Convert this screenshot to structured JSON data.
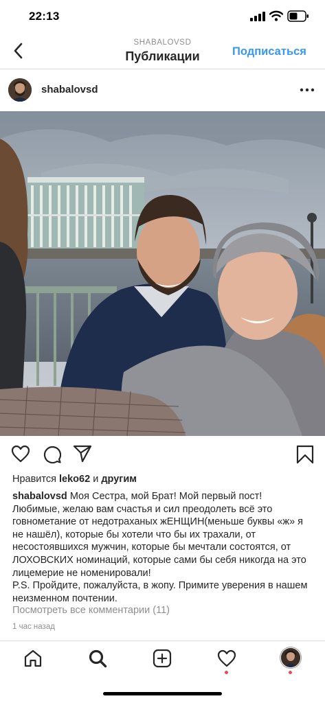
{
  "status_bar": {
    "time": "22:13",
    "signal_icon": "cellular-signal-icon",
    "wifi_icon": "wifi-icon",
    "battery_icon": "battery-icon"
  },
  "header": {
    "back_icon": "chevron-left-icon",
    "username": "SHABALOVSD",
    "title": "Публикации",
    "follow_label": "Подписаться",
    "accent_color": "#3897f0"
  },
  "post": {
    "username": "shabalovsd",
    "more_icon": "more-horizontal-icon",
    "photo_description_icon": "photo",
    "actions": {
      "like_icon": "heart-icon",
      "comment_icon": "comment-icon",
      "share_icon": "send-icon",
      "save_icon": "bookmark-icon"
    },
    "likes": {
      "prefix": "Нравится",
      "user": "leko62",
      "connector": "и",
      "others": "другим"
    },
    "caption": {
      "user": "shabalovsd",
      "text": "Моя Сестра, мой Брат! Мой первый пост!\nЛюбимые, желаю вам счастья и сил преодолеть всё это говнометание от недотраханых  жЕНЩИН(меньше буквы «ж» я не нашёл), которые бы хотели что бы их трахали, от несостоявшихся мужчин, которые  бы мечтали состоятся, от ЛОХОВСКИХ номинаций, которые сами бы себя никогда на это лицемерие не номенировали!\nP.S. Пройдите, пожалуйста, в жопу. Примите уверения в нашем неизменном почтении."
    },
    "view_comments": "Посмотреть все комментарии (11)",
    "time_ago": "1 час назад"
  },
  "bottom_nav": {
    "home_icon": "home-icon",
    "search_icon": "search-icon",
    "add_icon": "add-post-icon",
    "activity_icon": "heart-icon",
    "profile_icon": "profile-avatar",
    "notification_color": "#ed4956"
  }
}
